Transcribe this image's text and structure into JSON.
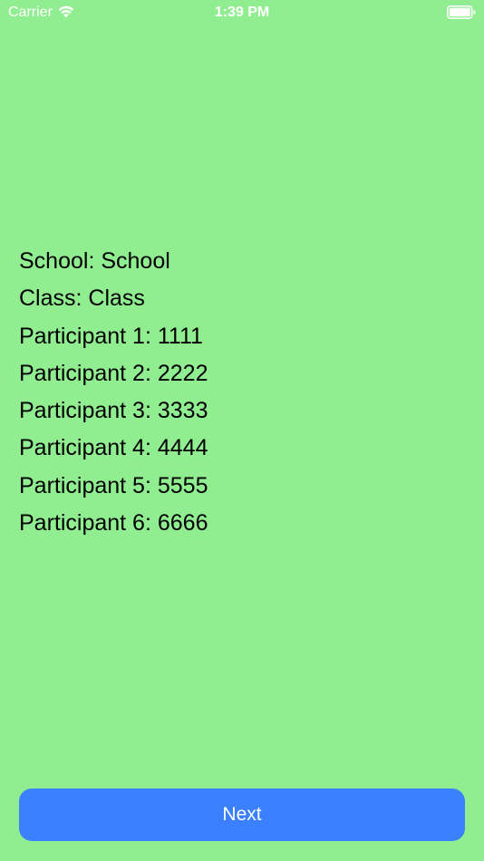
{
  "status_bar": {
    "carrier": "Carrier",
    "time": "1:39 PM",
    "wifi_icon": "wifi-icon",
    "battery_icon": "battery-icon"
  },
  "info": {
    "school": "School: School",
    "class": "Class: Class",
    "participants": [
      "Participant 1: 1111",
      "Participant 2: 2222",
      "Participant 3: 3333",
      "Participant 4: 4444",
      "Participant 5: 5555",
      "Participant 6: 6666"
    ]
  },
  "next_button": {
    "label": "Next"
  },
  "colors": {
    "background": "#90ee90",
    "button": "#3a80ff",
    "text": "#000000",
    "button_text": "#ffffff"
  }
}
